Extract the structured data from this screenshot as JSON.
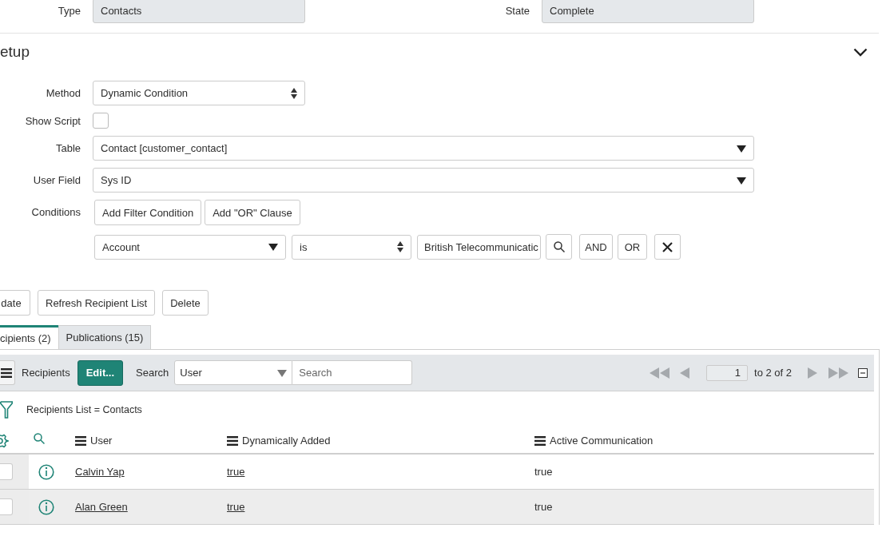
{
  "header_fields": [
    {
      "label": "Type",
      "value": "Contacts"
    },
    {
      "label": "State",
      "value": "Complete"
    }
  ],
  "section": {
    "title": "etup",
    "expanded": true,
    "fields": [
      {
        "kind": "select",
        "label": "Method",
        "value": "Dynamic Condition"
      },
      {
        "kind": "checkbox",
        "label": "Show Script",
        "checked": false
      },
      {
        "kind": "reference",
        "label": "Table",
        "value": "Contact [customer_contact]"
      },
      {
        "kind": "reference",
        "label": "User Field",
        "value": "Sys ID"
      }
    ],
    "conditions": {
      "label": "Conditions",
      "buttons": [
        "Add Filter Condition",
        "Add \"OR\" Clause"
      ],
      "field": "Account",
      "operator": "is",
      "value": "British Telecommunicatic",
      "and": "AND",
      "or": "OR"
    }
  },
  "actions": [
    "date",
    "Refresh Recipient List",
    "Delete"
  ],
  "tabs": [
    {
      "label": "cipients (2)",
      "selected": true
    },
    {
      "label": "Publications (15)",
      "selected": false
    }
  ],
  "list": {
    "title": "Recipients",
    "edit": "Edit...",
    "search_label": "Search",
    "search_field": "User",
    "search_placeholder": "Search",
    "page": "1",
    "range": "to 2 of 2",
    "breadcrumb": "Recipients List = Contacts",
    "columns": [
      "User",
      "Dynamically Added",
      "Active Communication"
    ],
    "rows": [
      {
        "checked": false,
        "cells": [
          "Calvin Yap",
          "true",
          "true"
        ]
      },
      {
        "checked": false,
        "cells": [
          "Alan Green",
          "true",
          "true"
        ]
      }
    ]
  }
}
